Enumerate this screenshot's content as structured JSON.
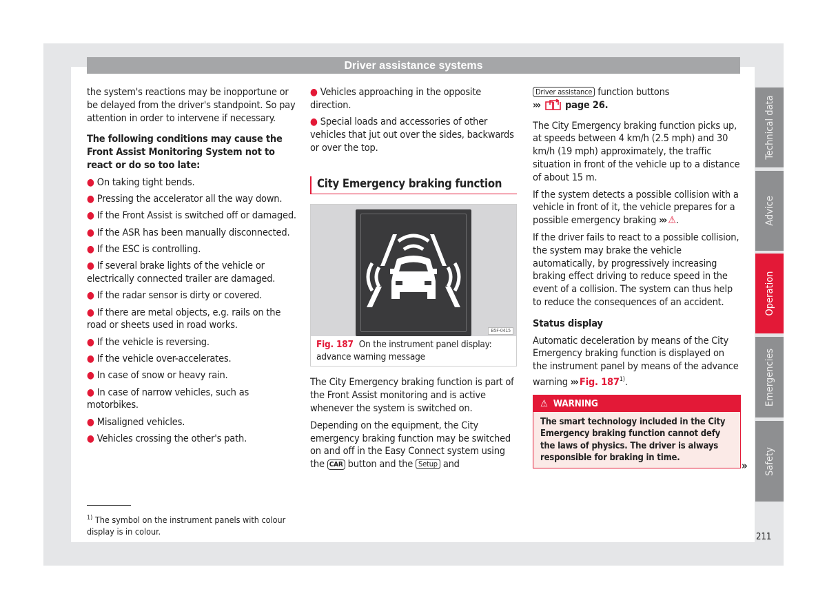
{
  "header": {
    "title": "Driver assistance systems"
  },
  "col1": {
    "intro": "the system's reactions may be inopportune or be delayed from the driver's standpoint. So pay attention in order to intervene if necessary.",
    "conditions_heading": "The following conditions may cause the Front Assist Monitoring System not to react or do so too late:",
    "conditions": [
      "On taking tight bends.",
      "Pressing the accelerator all the way down.",
      "If the Front Assist is switched off or damaged.",
      "If the ASR has been manually disconnected.",
      "If the ESC is controlling.",
      "If several brake lights of the vehicle or electrically connected trailer are damaged.",
      "If the radar sensor is dirty or covered.",
      "If there are metal objects, e.g. rails on the road or sheets used in road works.",
      "If the vehicle is reversing.",
      "If the vehicle over-accelerates.",
      "In case of snow or heavy rain.",
      "In case of narrow vehicles, such as motorbikes.",
      "Misaligned vehicles.",
      "Vehicles crossing the other's path."
    ],
    "footnote_mark": "1)",
    "footnote": "The symbol on the instrument panels with colour display is in colour."
  },
  "col2": {
    "bullets": [
      "Vehicles approaching in the opposite direction.",
      "Special loads and accessories of other vehicles that jut out over the sides, backwards or over the top."
    ],
    "section_title": "City Emergency braking function",
    "figure": {
      "code": "B5F-0415",
      "label": "Fig. 187",
      "caption": "On the instrument panel display: advance warning message"
    },
    "para1": "The City Emergency braking function is part of the Front Assist monitoring and is active whenever the system is switched on.",
    "para2_before": "Depending on the equipment, the City emergency braking function may be switched on and off in the Easy Connect system using the",
    "car_key": "CAR",
    "para2_mid": "button and the",
    "setup_key": "Setup",
    "para2_after": "and"
  },
  "col3": {
    "driver_assist_key": "Driver assistance",
    "function_buttons": "function buttons",
    "arrows": "›››",
    "page_ref": "page 26.",
    "para1": "The City Emergency braking function picks up, at speeds between 4 km/h (2.5 mph) and 30 km/h (19 mph) approximately, the traffic situation in front of the vehicle up to a distance of about 15 m.",
    "para2": "If the system detects a possible collision with a vehicle in front of it, the vehicle prepares for a possible emergency braking",
    "para3": "If the driver fails to react to a possible collision, the system may brake the vehicle automatically, by progressively increasing braking effect driving to reduce speed in the event of a collision. The system can thus help to reduce the consequences of an accident.",
    "status_heading": "Status display",
    "status_text": "Automatic deceleration by means of the City Emergency braking function is displayed on the instrument panel by means of the advance warning",
    "fig_ref": "Fig. 187",
    "fig_ref_sup": "1)",
    "warning": {
      "title": "WARNING",
      "text": "The smart technology included in the City Emergency braking function cannot defy the laws of physics. The driver is always responsible for braking in time."
    },
    "continue_mark": "»"
  },
  "side_tabs": [
    {
      "label": "Technical data",
      "active": false
    },
    {
      "label": "Advice",
      "active": false
    },
    {
      "label": "Operation",
      "active": true
    },
    {
      "label": "Emergencies",
      "active": false
    },
    {
      "label": "Safety",
      "active": false
    }
  ],
  "page_number": "211",
  "colors": {
    "accent": "#e31937",
    "header_gray": "#a5a6a8",
    "tab_gray": "#8e8f91",
    "frame_gray": "#e5e6e8"
  }
}
